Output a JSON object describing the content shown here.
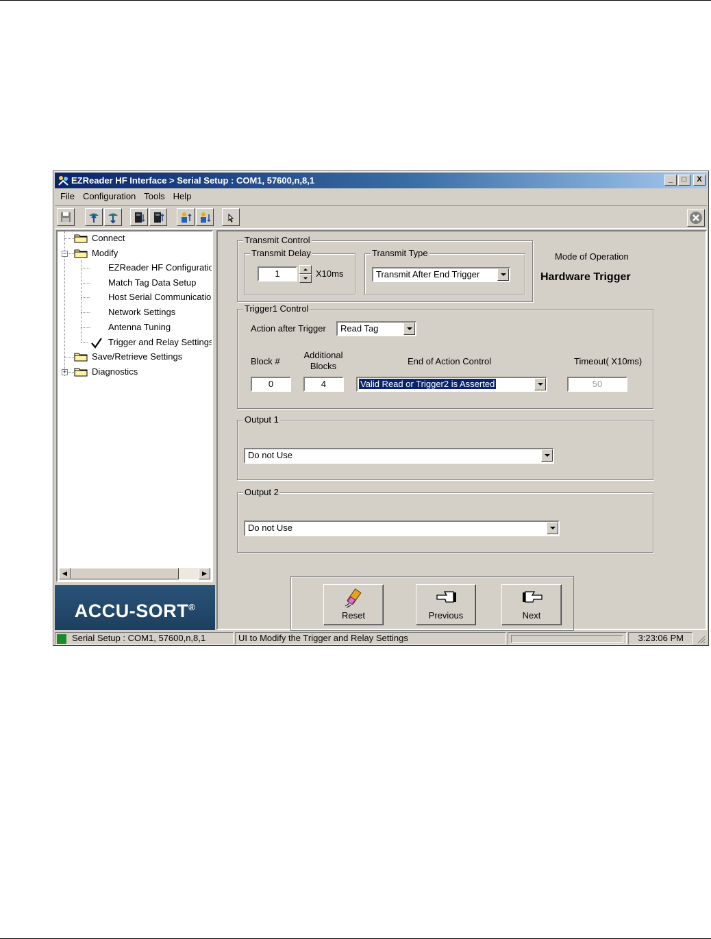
{
  "window": {
    "title": "EZReader HF Interface > Serial Setup : COM1, 57600,n,8,1",
    "minimize_glyph": "_",
    "maximize_glyph": "□",
    "close_glyph": "X"
  },
  "menu": [
    "File",
    "Configuration",
    "Tools",
    "Help"
  ],
  "toolbar": {
    "icons": [
      "save-icon",
      "upload-icon",
      "download-icon",
      "reader-read-icon",
      "reader-write-icon",
      "user-up-icon",
      "user-down-icon",
      "pointer-icon"
    ],
    "close_icon": "circle-x-icon"
  },
  "tree": {
    "connect": "Connect",
    "modify": "Modify",
    "modify_children": [
      "EZReader HF Configuratio",
      "Match Tag Data Setup",
      "Host Serial Communication",
      "Network Settings",
      "Antenna Tuning",
      "Trigger and Relay Settings"
    ],
    "checked_item": "Trigger and Relay Settings",
    "save_retrieve": "Save/Retrieve Settings",
    "diagnostics": "Diagnostics",
    "scroll_left": "◀",
    "scroll_right": "▶"
  },
  "logo": {
    "text": "ACCU-SORT",
    "mark": "®"
  },
  "transmit_control": {
    "title": "Transmit Control",
    "delay_title": "Transmit Delay",
    "delay_value": "1",
    "delay_unit": "X10ms",
    "type_title": "Transmit Type",
    "type_value": "Transmit After End Trigger"
  },
  "mode": {
    "label": "Mode of Operation",
    "value": "Hardware Trigger"
  },
  "trigger1": {
    "title": "Trigger1 Control",
    "action_label": "Action after Trigger",
    "action_value": "Read Tag",
    "block_label": "Block #",
    "block_value": "0",
    "additional_label_1": "Additional",
    "additional_label_2": "Blocks",
    "additional_value": "4",
    "end_label": "End of Action Control",
    "end_value": "Valid Read or Trigger2 is Asserted",
    "timeout_label": "Timeout( X10ms)",
    "timeout_value": "50"
  },
  "output1": {
    "title": "Output 1",
    "value": "Do not Use"
  },
  "output2": {
    "title": "Output 2",
    "value": "Do not Use"
  },
  "nav": {
    "reset": "Reset",
    "previous": "Previous",
    "next": "Next"
  },
  "status": {
    "connection": "Serial Setup : COM1, 57600,n,8,1",
    "message": "UI to Modify the Trigger and Relay Settings",
    "progress": 0,
    "time": "3:23:06 PM"
  },
  "colors": {
    "face": "#d4d0c8",
    "title_start": "#0a246a",
    "title_end": "#a6caf0",
    "selection": "#0a246a",
    "logo_bg": "#1d3f5f",
    "status_led": "#1a8a2a"
  }
}
